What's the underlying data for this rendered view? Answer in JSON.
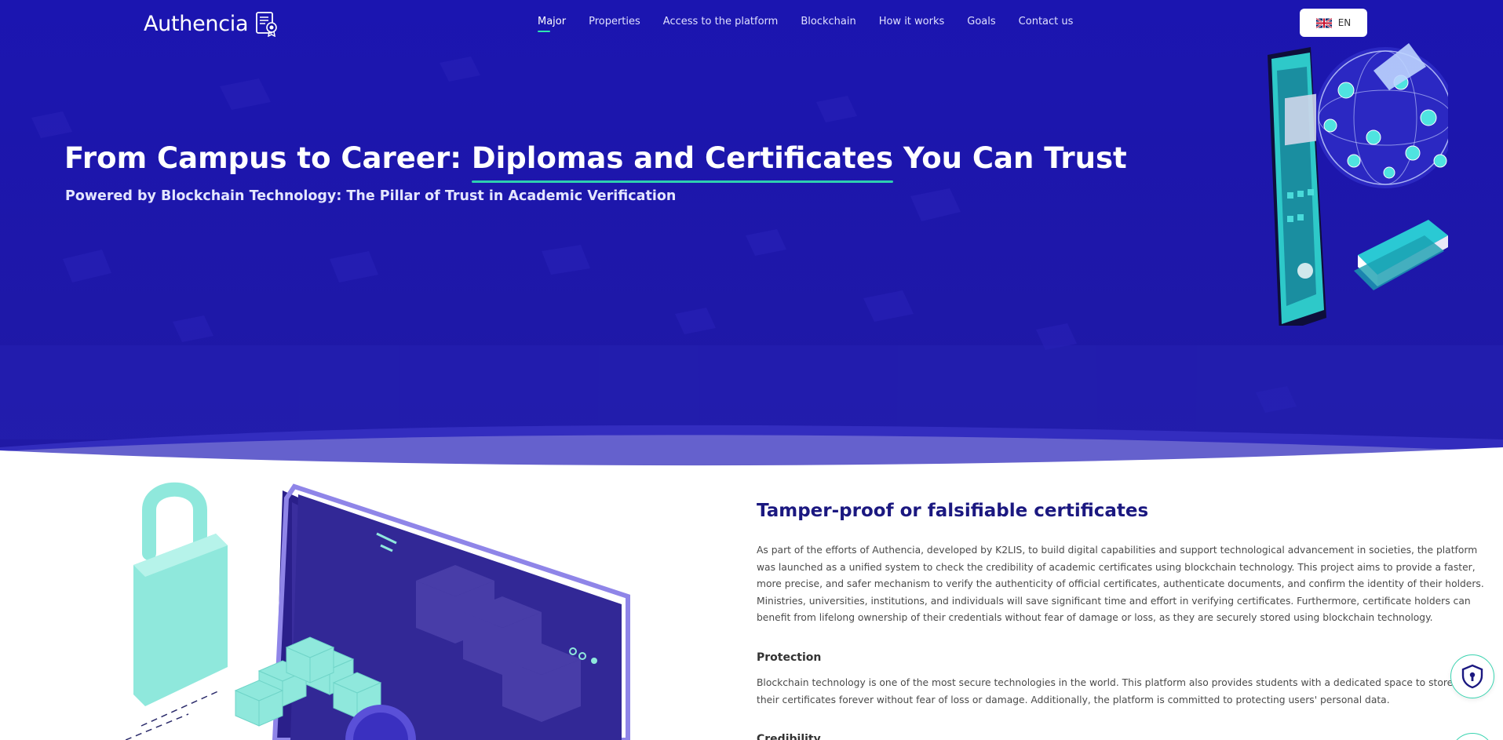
{
  "brand": {
    "name": "Authencia",
    "logo_icon": "certificate-icon"
  },
  "nav": {
    "items": [
      {
        "label": "Major",
        "active": true
      },
      {
        "label": "Properties",
        "active": false
      },
      {
        "label": "Access to the platform",
        "active": false
      },
      {
        "label": "Blockchain",
        "active": false
      },
      {
        "label": "How it works",
        "active": false
      },
      {
        "label": "Goals",
        "active": false
      },
      {
        "label": "Contact us",
        "active": false
      }
    ],
    "language": {
      "label": "EN",
      "flag_icon": "uk-flag-icon"
    }
  },
  "hero": {
    "title_prefix": "From Campus to Career: ",
    "title_highlight": "Diplomas and Certificates",
    "title_suffix": " You Can Trust",
    "subtitle": "Powered by Blockchain Technology: The Pillar of Trust in Academic Verification"
  },
  "section": {
    "title": "Tamper-proof or falsifiable certificates",
    "paragraph": "As part of the efforts of Authencia, developed by K2LIS, to build digital capabilities and support technological advancement in societies, the platform was launched as a unified system to check the credibility of academic certificates using blockchain technology. This project aims to provide a faster, more precise, and safer mechanism to verify the authenticity of official certificates, authenticate documents, and confirm the identity of their holders. Ministries, universities, institutions, and individuals will save significant time and effort in verifying certificates. Furthermore, certificate holders can benefit from lifelong ownership of their credentials without fear of damage or loss, as they are securely stored using blockchain technology.",
    "protection_title": "Protection",
    "protection_text": "Blockchain technology is one of the most secure technologies in the world. This platform also provides students with a dedicated space to store their certificates forever without fear of loss or damage. Additionally, the platform is committed to protecting users' personal data.",
    "credibility_title": "Credibility"
  },
  "colors": {
    "hero_bg": "#1a14a8",
    "accent": "#2ee6b0",
    "title_dark": "#1b1880"
  }
}
